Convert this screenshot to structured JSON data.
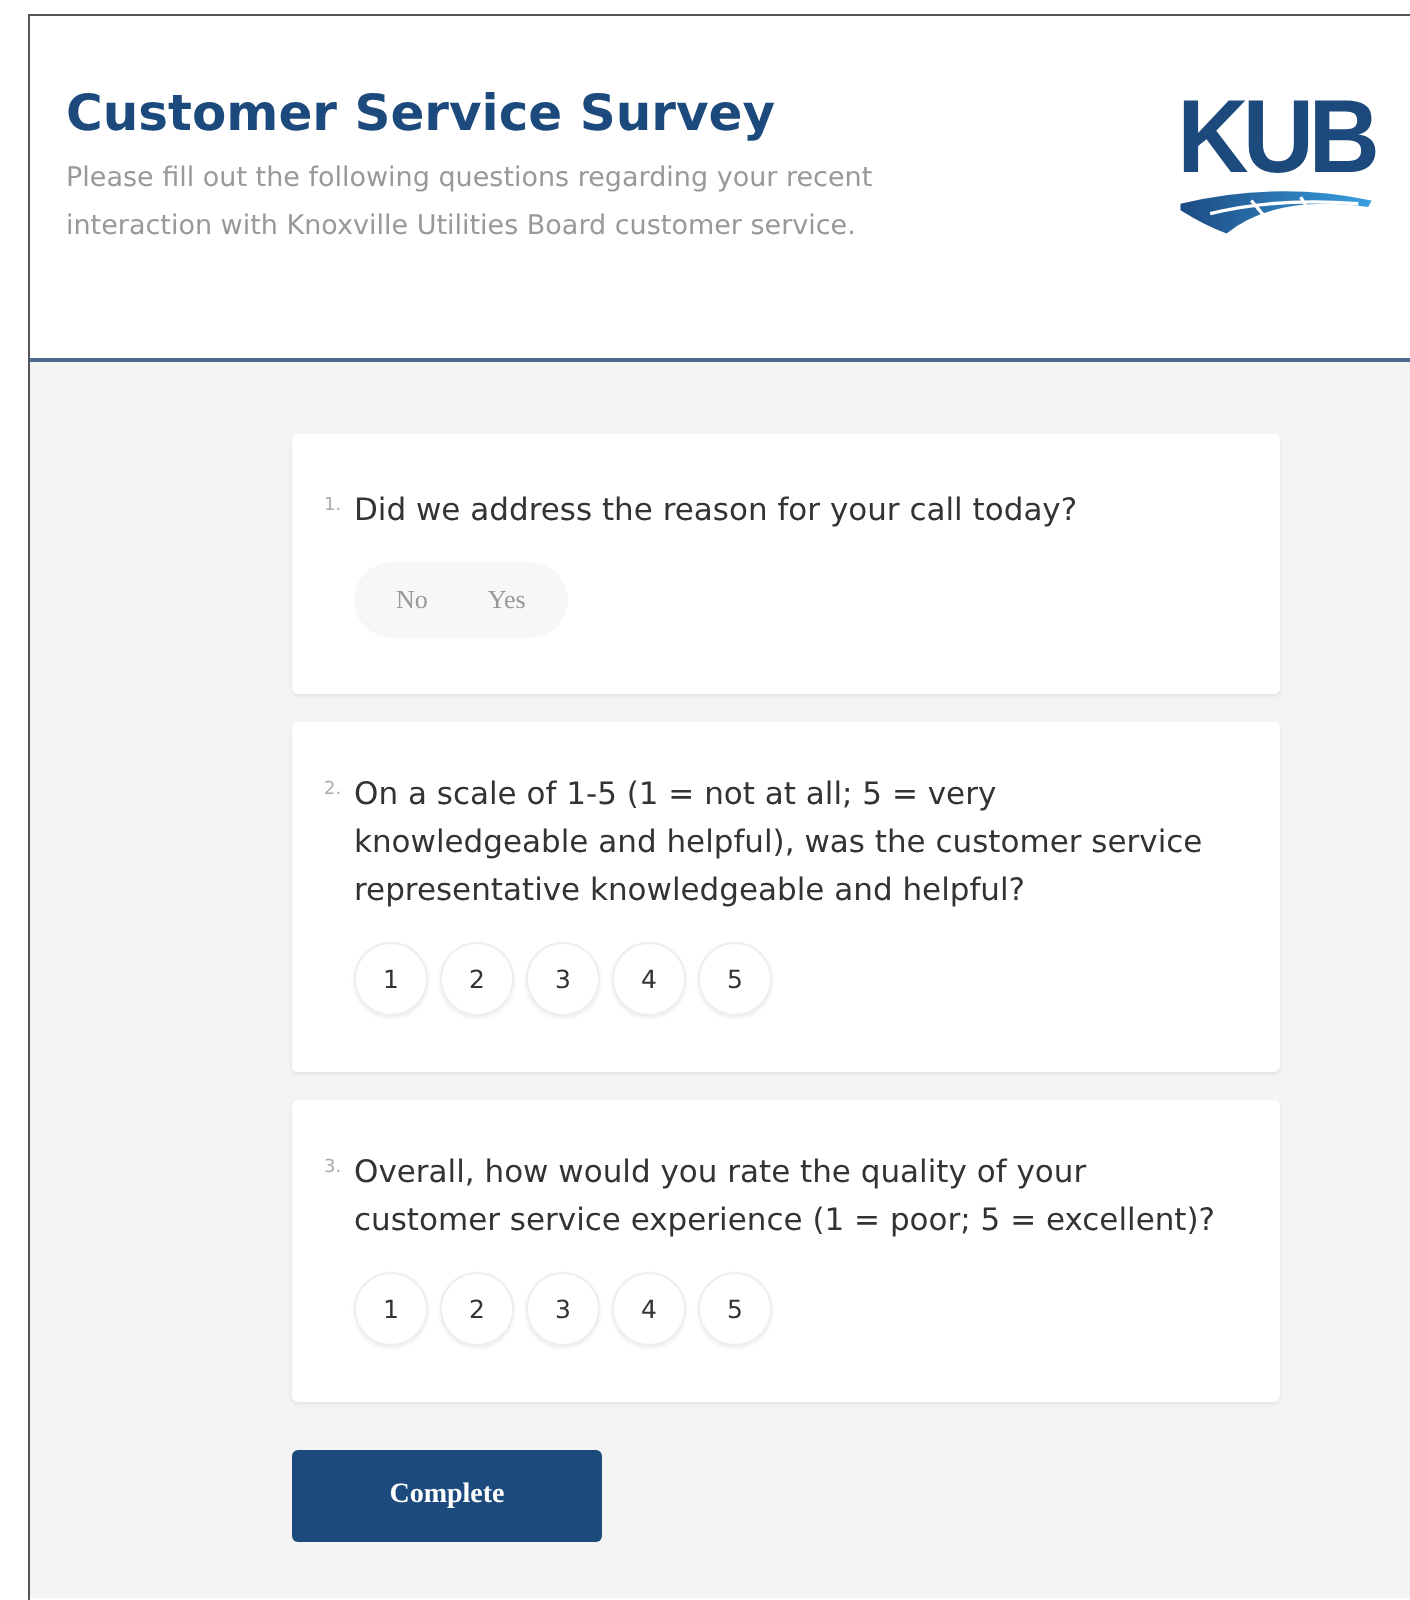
{
  "header": {
    "title": "Customer Service Survey",
    "description": "Please fill out the following questions regarding your recent interaction with Knoxville Utilities Board customer service.",
    "logo": "KUB"
  },
  "questions": [
    {
      "number": "1.",
      "text": "Did we address the reason for your call today?",
      "kind": "toggle",
      "options": [
        {
          "label": "No",
          "selected": false
        },
        {
          "label": "Yes",
          "selected": false
        }
      ]
    },
    {
      "number": "2.",
      "text": "On a scale of 1-5 (1 = not at all; 5 = very knowledgeable and helpful), was the customer service representative knowledgeable and helpful?",
      "kind": "scale",
      "options": [
        {
          "label": "1",
          "selected": false
        },
        {
          "label": "2",
          "selected": false
        },
        {
          "label": "3",
          "selected": false
        },
        {
          "label": "4",
          "selected": false
        },
        {
          "label": "5",
          "selected": false
        }
      ]
    },
    {
      "number": "3.",
      "text": "Overall, how would you rate the quality of your customer service experience (1 = poor; 5 = excellent)?",
      "kind": "scale",
      "options": [
        {
          "label": "1",
          "selected": false
        },
        {
          "label": "2",
          "selected": false
        },
        {
          "label": "3",
          "selected": false
        },
        {
          "label": "4",
          "selected": false
        },
        {
          "label": "5",
          "selected": false
        }
      ]
    }
  ],
  "submit": "Complete"
}
